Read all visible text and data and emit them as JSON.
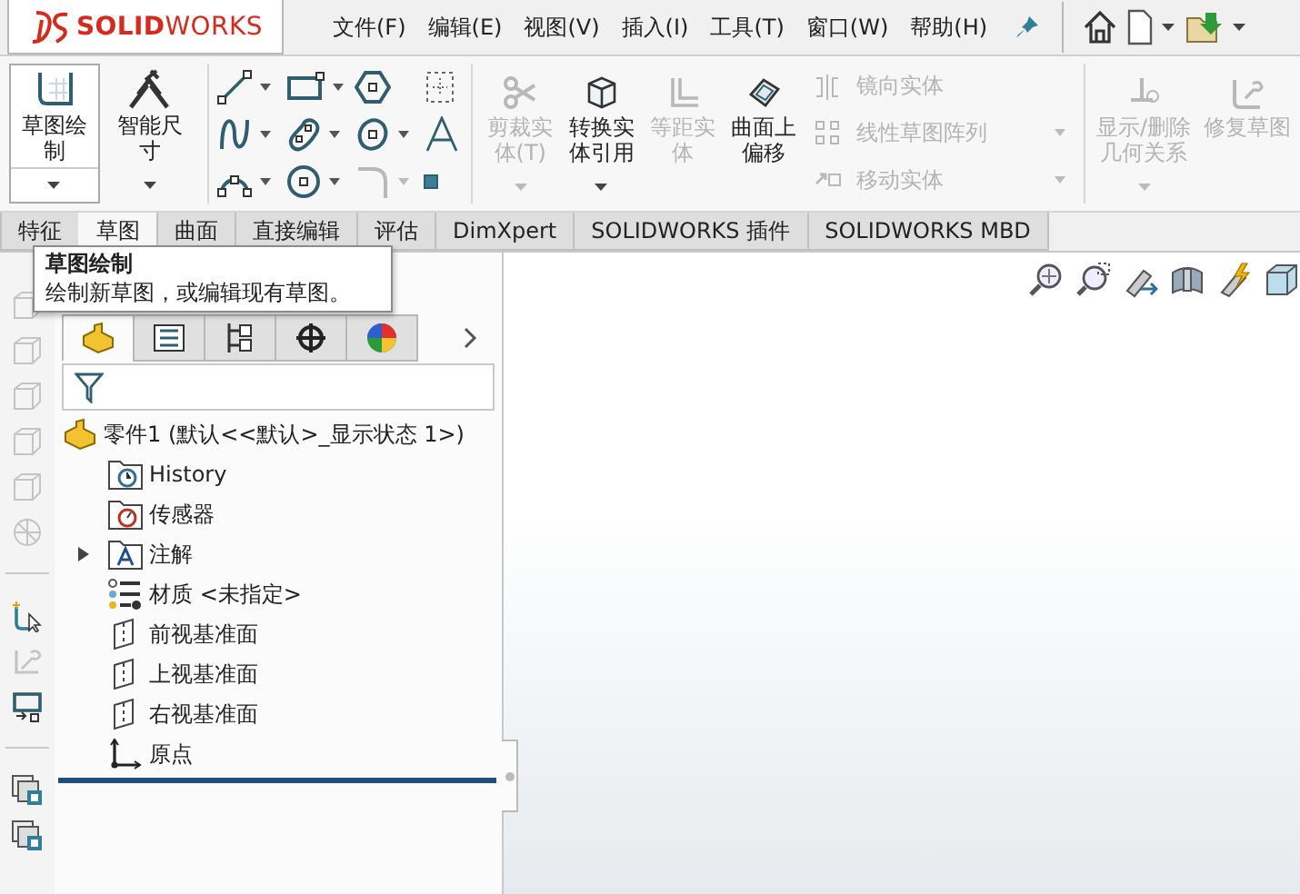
{
  "app_logo": {
    "text": "**SOLID**WORKS"
  },
  "menu": [
    "文件(F)",
    "编辑(E)",
    "视图(V)",
    "插入(I)",
    "工具(T)",
    "窗口(W)",
    "帮助(H)"
  ],
  "ribbon": {
    "big_buttons": [
      {
        "label": "草图绘制",
        "kind": "sketch",
        "disabled": false,
        "dropdown": true,
        "hovered": true
      },
      {
        "label": "智能尺寸",
        "kind": "dimension",
        "disabled": false,
        "dropdown": true,
        "hovered": false
      }
    ],
    "sketch_tools": [
      {
        "kind": "line",
        "dropdown": true,
        "disabled": false
      },
      {
        "kind": "rectangle",
        "dropdown": true,
        "disabled": false
      },
      {
        "kind": "polygon",
        "dropdown": false,
        "disabled": false
      },
      {
        "kind": "construction",
        "dropdown": false,
        "disabled": false
      },
      {
        "kind": "spline",
        "dropdown": true,
        "disabled": false
      },
      {
        "kind": "slot",
        "dropdown": true,
        "disabled": false
      },
      {
        "kind": "ellipse",
        "dropdown": true,
        "disabled": false
      },
      {
        "kind": "text",
        "dropdown": false,
        "disabled": false
      },
      {
        "kind": "arc",
        "dropdown": true,
        "disabled": false
      },
      {
        "kind": "circle",
        "dropdown": true,
        "disabled": false
      },
      {
        "kind": "fillet",
        "dropdown": true,
        "disabled": true
      },
      {
        "kind": "point",
        "dropdown": false,
        "disabled": false
      }
    ],
    "entity_buttons": [
      {
        "label": "剪裁实体(T)",
        "kind": "trim",
        "disabled": true,
        "dropdown": true
      },
      {
        "label": "转换实体引用",
        "kind": "convert",
        "disabled": false,
        "dropdown": true
      },
      {
        "label": "等距实体",
        "kind": "offset",
        "disabled": true,
        "dropdown": false
      },
      {
        "label": "曲面上偏移",
        "kind": "surface-offset",
        "disabled": false,
        "dropdown": false
      }
    ],
    "small_tools": [
      {
        "label": "镜向实体",
        "kind": "mirror",
        "disabled": true,
        "dropdown": false
      },
      {
        "label": "线性草图阵列",
        "kind": "pattern",
        "disabled": true,
        "dropdown": true
      },
      {
        "label": "移动实体",
        "kind": "move",
        "disabled": true,
        "dropdown": true
      }
    ],
    "relation_buttons": [
      {
        "label": "显示/删除几何关系",
        "kind": "relations",
        "disabled": true,
        "dropdown": true
      },
      {
        "label": "修复草图",
        "kind": "repair",
        "disabled": true,
        "dropdown": false
      }
    ]
  },
  "tabs": [
    {
      "label": "特征",
      "selected": false
    },
    {
      "label": "草图",
      "selected": true
    },
    {
      "label": "曲面",
      "selected": false
    },
    {
      "label": "直接编辑",
      "selected": false
    },
    {
      "label": "评估",
      "selected": false
    },
    {
      "label": "DimXpert",
      "selected": false
    },
    {
      "label": "SOLIDWORKS 插件",
      "selected": false
    },
    {
      "label": "SOLIDWORKS MBD",
      "selected": false
    }
  ],
  "tooltip": {
    "title": "草图绘制",
    "text": "绘制新草图，或编辑现有草图。"
  },
  "left_toolbar": [
    {
      "kind": "cube",
      "disabled": true
    },
    {
      "kind": "cube",
      "disabled": true
    },
    {
      "kind": "cube",
      "disabled": true
    },
    {
      "kind": "cube",
      "disabled": true
    },
    {
      "kind": "cube",
      "disabled": true
    },
    {
      "kind": "sphere",
      "disabled": true
    },
    {
      "kind": "separator"
    },
    {
      "kind": "sketch",
      "disabled": false
    },
    {
      "kind": "wrench",
      "disabled": true
    },
    {
      "kind": "monitor",
      "disabled": false
    },
    {
      "kind": "separator"
    },
    {
      "kind": "stack",
      "disabled": false
    },
    {
      "kind": "stack",
      "disabled": false
    }
  ],
  "feature_manager": {
    "tabs": [
      {
        "kind": "feature-tree",
        "selected": true
      },
      {
        "kind": "property",
        "selected": false
      },
      {
        "kind": "configuration",
        "selected": false
      },
      {
        "kind": "crosshair",
        "selected": false
      },
      {
        "kind": "display",
        "selected": false
      }
    ],
    "tree": {
      "label": "零件1  (默认<<默认>_显示状态 1>)",
      "kind": "part",
      "children": [
        {
          "label": "History",
          "kind": "history",
          "expandable": false
        },
        {
          "label": "传感器",
          "kind": "sensor",
          "expandable": false
        },
        {
          "label": "注解",
          "kind": "annotation",
          "expandable": true
        },
        {
          "label": "材质 <未指定>",
          "kind": "material",
          "expandable": false
        },
        {
          "label": "前视基准面",
          "kind": "plane",
          "expandable": false
        },
        {
          "label": "上视基准面",
          "kind": "plane",
          "expandable": false
        },
        {
          "label": "右视基准面",
          "kind": "plane",
          "expandable": false
        },
        {
          "label": "原点",
          "kind": "origin",
          "expandable": false
        }
      ]
    }
  }
}
